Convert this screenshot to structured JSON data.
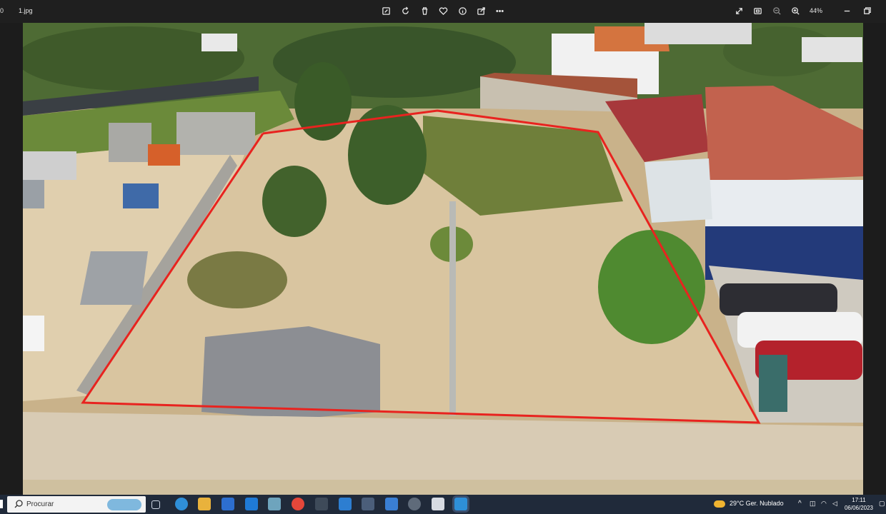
{
  "window": {
    "filename": "1.jpg",
    "left_edge_text": "0",
    "zoom_level": "44%"
  },
  "toolbar": {
    "center_icons": [
      "edit-icon",
      "rotate-icon",
      "delete-icon",
      "favorite-icon",
      "info-icon",
      "share-icon",
      "more-icon"
    ],
    "right_icons": [
      "fullscreen-icon",
      "fit-icon",
      "zoom-out-icon",
      "zoom-in-icon",
      "minimize-icon",
      "restore-icon"
    ]
  },
  "taskbar": {
    "search_placeholder": "Procurar",
    "weather": "29°C  Ger. Nublado",
    "time": "17:11",
    "date": "06/06/2023",
    "apps": [
      "task-view-icon",
      "edge-icon",
      "file-explorer-icon",
      "store-icon",
      "mail-icon",
      "app-icon",
      "chrome-icon",
      "calculator-icon",
      "app-icon",
      "app-icon",
      "app-icon",
      "app-icon",
      "app-icon",
      "photos-icon"
    ]
  },
  "photo": {
    "subject": "aerial-plot-photo",
    "outline_color": "#e8231f"
  }
}
